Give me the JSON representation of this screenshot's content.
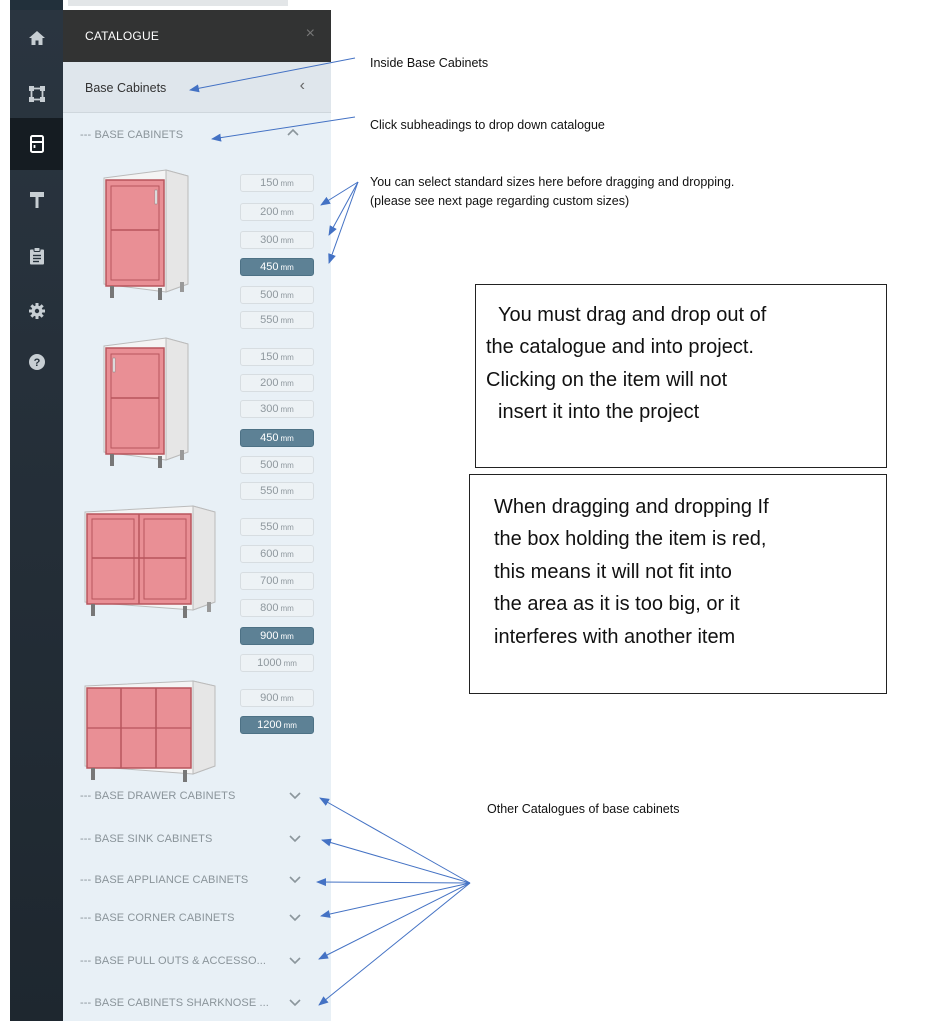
{
  "rail": {
    "icons": [
      "home-icon",
      "floorplan-icon",
      "cabinet-icon",
      "paint-roller-icon",
      "clipboard-icon",
      "gear-icon",
      "help-icon"
    ]
  },
  "panel": {
    "title": "CATALOGUE",
    "close_label": "×",
    "breadcrumb": "Base Cabinets",
    "back_label": "‹",
    "open_section": "--- BASE CABINETS",
    "products": [
      {
        "sizes": [
          {
            "n": "150",
            "u": "mm"
          },
          {
            "n": "200",
            "u": "mm"
          },
          {
            "n": "300",
            "u": "mm"
          },
          {
            "n": "450",
            "u": "mm",
            "selected": true
          },
          {
            "n": "500",
            "u": "mm"
          },
          {
            "n": "550",
            "u": "mm"
          }
        ]
      },
      {
        "sizes": [
          {
            "n": "150",
            "u": "mm"
          },
          {
            "n": "200",
            "u": "mm"
          },
          {
            "n": "300",
            "u": "mm"
          },
          {
            "n": "450",
            "u": "mm",
            "selected": true
          },
          {
            "n": "500",
            "u": "mm"
          },
          {
            "n": "550",
            "u": "mm"
          }
        ]
      },
      {
        "sizes": [
          {
            "n": "550",
            "u": "mm"
          },
          {
            "n": "600",
            "u": "mm"
          },
          {
            "n": "700",
            "u": "mm"
          },
          {
            "n": "800",
            "u": "mm"
          },
          {
            "n": "900",
            "u": "mm",
            "selected": true
          },
          {
            "n": "1000",
            "u": "mm"
          }
        ]
      },
      {
        "sizes": [
          {
            "n": "900",
            "u": "mm"
          },
          {
            "n": "1200",
            "u": "mm",
            "selected": true
          }
        ]
      }
    ],
    "sections": [
      "--- BASE DRAWER CABINETS",
      "--- BASE SINK CABINETS",
      "--- BASE APPLIANCE CABINETS",
      "--- BASE CORNER CABINETS",
      "--- BASE PULL OUTS & ACCESSO...",
      "--- BASE CABINETS SHARKNOSE ..."
    ]
  },
  "annotations": {
    "inside": "Inside Base Cabinets",
    "subheadings": "Click subheadings to drop down catalogue",
    "sizes_line1": "You can select standard sizes here before dragging and dropping.",
    "sizes_line2": "(please see next page regarding custom sizes)",
    "box1": [
      "You must drag and drop out of",
      "the catalogue and into project.",
      "Clicking on the item will not",
      "insert it into the project"
    ],
    "box2": [
      "When dragging and dropping If",
      "the box holding the item is red,",
      "this means it will not fit into",
      "the area as it is too big, or it",
      "interferes with another item"
    ],
    "other": "Other Catalogues of base cabinets"
  },
  "colors": {
    "rail": "#2a3540",
    "panel": "#e8f0f6",
    "selected_size": "#5d8195",
    "cabinet_red": "#e98f95",
    "arrow": "#4472c4"
  }
}
